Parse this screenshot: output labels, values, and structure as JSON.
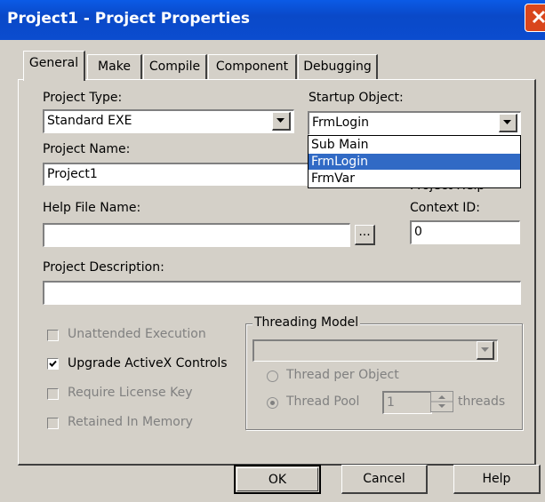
{
  "window": {
    "title": "Project1 - Project Properties",
    "close_icon": "close-x"
  },
  "tabs": [
    {
      "label": "General",
      "active": true
    },
    {
      "label": "Make"
    },
    {
      "label": "Compile"
    },
    {
      "label": "Component"
    },
    {
      "label": "Debugging"
    }
  ],
  "general": {
    "project_type": {
      "label": "Project Type:",
      "value": "Standard EXE"
    },
    "startup_object": {
      "label": "Startup Object:",
      "value": "FrmLogin",
      "options": [
        {
          "label": "Sub Main",
          "selected": false
        },
        {
          "label": "FrmLogin",
          "selected": true
        },
        {
          "label": "FrmVar",
          "selected": false
        }
      ]
    },
    "project_name": {
      "label": "Project Name:",
      "value": "Project1"
    },
    "project_help_context": {
      "label_line1": "Project Help",
      "label_line2": "Context ID:",
      "value": "0"
    },
    "help_file": {
      "label": "Help File Name:",
      "value": "",
      "browse_label": "..."
    },
    "project_description": {
      "label": "Project Description:",
      "value": ""
    },
    "options": [
      {
        "label": "Unattended Execution",
        "checked": false,
        "enabled": false
      },
      {
        "label": "Upgrade ActiveX Controls",
        "checked": true,
        "enabled": true
      },
      {
        "label": "Require License Key",
        "checked": false,
        "enabled": false
      },
      {
        "label": "Retained In Memory",
        "checked": false,
        "enabled": false
      }
    ],
    "threading": {
      "group_label": "Threading Model",
      "model_value": "",
      "thread_per_object": "Thread per Object",
      "thread_pool": "Thread Pool",
      "pool_count": "1",
      "threads_label": "threads"
    }
  },
  "buttons": {
    "ok": "OK",
    "cancel": "Cancel",
    "help": "Help"
  },
  "colors": {
    "title_bar": "#0a49c8",
    "selection": "#316ac5",
    "dialog_face": "#d4d0c8",
    "close_button": "#d9461c"
  }
}
